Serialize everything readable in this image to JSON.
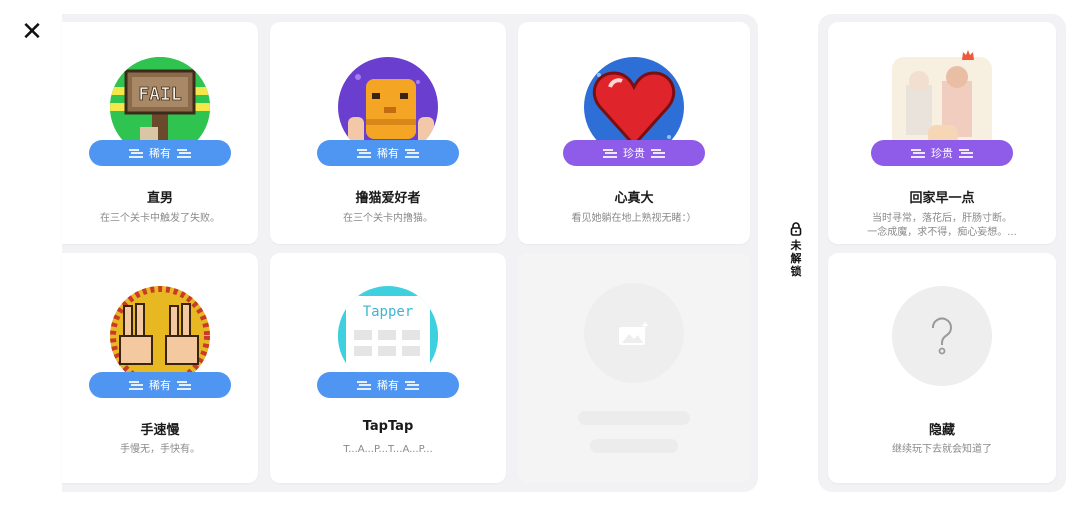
{
  "close_icon": "✕",
  "unlock_label": {
    "chars": [
      "未",
      "解",
      "锁"
    ]
  },
  "cards": [
    {
      "title": "直男",
      "desc": "在三个关卡中触发了失败。",
      "badge": "稀有",
      "rarity": "rare",
      "image": "fail-sign"
    },
    {
      "title": "撸猫爱好者",
      "desc": "在三个关卡内撸猫。",
      "badge": "稀有",
      "rarity": "rare",
      "image": "cat-paws"
    },
    {
      "title": "心真大",
      "desc": "看见她躺在地上熟视无睹：）",
      "badge": "珍贵",
      "rarity": "precious",
      "image": "heart"
    },
    {
      "title": "手速慢",
      "desc": "手慢无，手快有。",
      "badge": "稀有",
      "rarity": "rare",
      "image": "victory-hands"
    },
    {
      "title": "TapTap",
      "desc": "T...A...P...T...A...P...",
      "badge": "稀有",
      "rarity": "rare",
      "image": "tapper-sign"
    }
  ],
  "right_cards": [
    {
      "title": "回家早一点",
      "desc1": "当时寻常，落花后，肝肠寸断。",
      "desc2": "一念成魔，求不得，痴心妄想。...",
      "badge": "珍贵",
      "rarity": "precious",
      "image": "family"
    },
    {
      "title": "隐藏",
      "desc": "继续玩下去就会知道了",
      "image": "question-mark"
    }
  ],
  "colors": {
    "rare": "#4f95f2",
    "precious": "#8e5ce8",
    "panel": "#f2f2f4"
  }
}
